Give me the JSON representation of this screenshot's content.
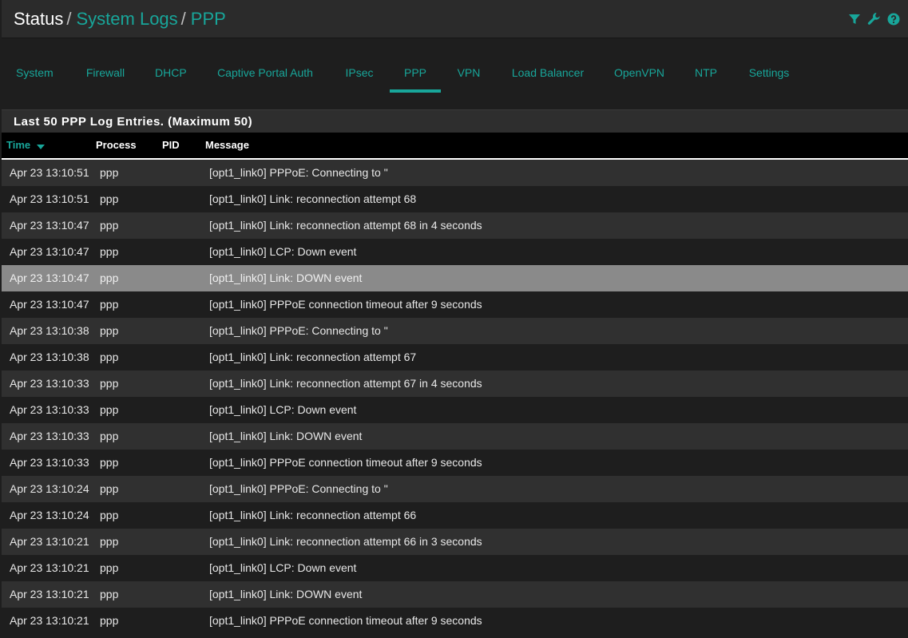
{
  "breadcrumb": {
    "status": "Status",
    "sep1": "/",
    "system_logs": "System Logs",
    "sep2": "/",
    "current": "PPP"
  },
  "header_icons": [
    "filter-icon",
    "wrench-icon",
    "help-icon"
  ],
  "accent_color": "#18a69a",
  "tabs": [
    {
      "label": "System"
    },
    {
      "label": "Firewall"
    },
    {
      "label": "DHCP"
    },
    {
      "label": "Captive Portal Auth"
    },
    {
      "label": "IPsec"
    },
    {
      "label": "PPP",
      "active": true
    },
    {
      "label": "VPN"
    },
    {
      "label": "Load Balancer"
    },
    {
      "label": "OpenVPN"
    },
    {
      "label": "NTP"
    },
    {
      "label": "Settings"
    }
  ],
  "panel": {
    "title": "Last 50 PPP Log Entries. (Maximum 50)"
  },
  "table": {
    "columns": {
      "time": "Time",
      "process": "Process",
      "pid": "PID",
      "message": "Message"
    },
    "rows": [
      {
        "time": "Apr 23 13:10:51",
        "process": "ppp",
        "pid": "",
        "message": "[opt1_link0] PPPoE: Connecting to \""
      },
      {
        "time": "Apr 23 13:10:51",
        "process": "ppp",
        "pid": "",
        "message": "[opt1_link0] Link: reconnection attempt 68"
      },
      {
        "time": "Apr 23 13:10:47",
        "process": "ppp",
        "pid": "",
        "message": "[opt1_link0] Link: reconnection attempt 68 in 4 seconds"
      },
      {
        "time": "Apr 23 13:10:47",
        "process": "ppp",
        "pid": "",
        "message": "[opt1_link0] LCP: Down event"
      },
      {
        "time": "Apr 23 13:10:47",
        "process": "ppp",
        "pid": "",
        "message": "[opt1_link0] Link: DOWN event",
        "highlighted": true
      },
      {
        "time": "Apr 23 13:10:47",
        "process": "ppp",
        "pid": "",
        "message": "[opt1_link0] PPPoE connection timeout after 9 seconds"
      },
      {
        "time": "Apr 23 13:10:38",
        "process": "ppp",
        "pid": "",
        "message": "[opt1_link0] PPPoE: Connecting to \""
      },
      {
        "time": "Apr 23 13:10:38",
        "process": "ppp",
        "pid": "",
        "message": "[opt1_link0] Link: reconnection attempt 67"
      },
      {
        "time": "Apr 23 13:10:33",
        "process": "ppp",
        "pid": "",
        "message": "[opt1_link0] Link: reconnection attempt 67 in 4 seconds"
      },
      {
        "time": "Apr 23 13:10:33",
        "process": "ppp",
        "pid": "",
        "message": "[opt1_link0] LCP: Down event"
      },
      {
        "time": "Apr 23 13:10:33",
        "process": "ppp",
        "pid": "",
        "message": "[opt1_link0] Link: DOWN event"
      },
      {
        "time": "Apr 23 13:10:33",
        "process": "ppp",
        "pid": "",
        "message": "[opt1_link0] PPPoE connection timeout after 9 seconds"
      },
      {
        "time": "Apr 23 13:10:24",
        "process": "ppp",
        "pid": "",
        "message": "[opt1_link0] PPPoE: Connecting to \""
      },
      {
        "time": "Apr 23 13:10:24",
        "process": "ppp",
        "pid": "",
        "message": "[opt1_link0] Link: reconnection attempt 66"
      },
      {
        "time": "Apr 23 13:10:21",
        "process": "ppp",
        "pid": "",
        "message": "[opt1_link0] Link: reconnection attempt 66 in 3 seconds"
      },
      {
        "time": "Apr 23 13:10:21",
        "process": "ppp",
        "pid": "",
        "message": "[opt1_link0] LCP: Down event"
      },
      {
        "time": "Apr 23 13:10:21",
        "process": "ppp",
        "pid": "",
        "message": "[opt1_link0] Link: DOWN event"
      },
      {
        "time": "Apr 23 13:10:21",
        "process": "ppp",
        "pid": "",
        "message": "[opt1_link0] PPPoE connection timeout after 9 seconds"
      }
    ]
  }
}
